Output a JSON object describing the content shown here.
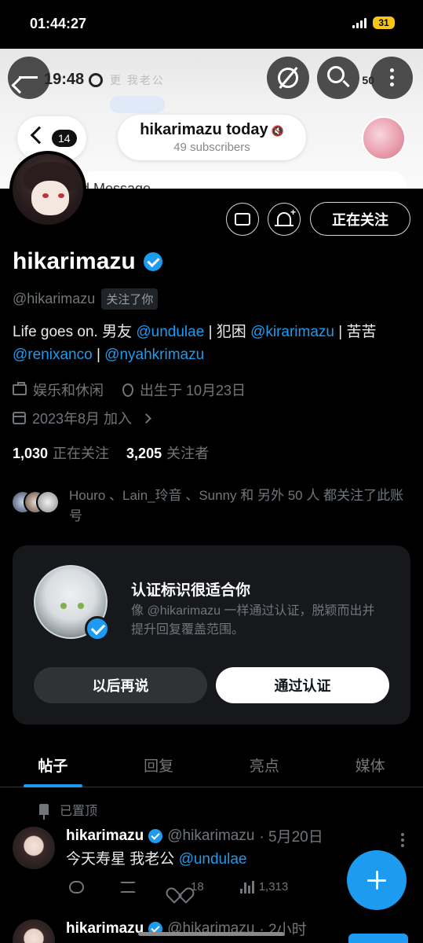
{
  "status_bar": {
    "time": "01:44:27",
    "battery": "31"
  },
  "banner": {
    "inner_time": "19:48",
    "inner_status": "50",
    "blurred_text": "更 我老公",
    "channel_title": "hikarimazu today",
    "subscribers": "49 subscribers",
    "back_count": "14",
    "message_partial": "d Message"
  },
  "header_icons": [
    "back-arrow-icon",
    "grok-icon",
    "search-icon",
    "more-icon"
  ],
  "profile": {
    "mail_button": "mail-icon",
    "notify_button": "bell-plus-icon",
    "follow_button": "正在关注",
    "display_name": "hikarimazu",
    "handle": "@hikarimazu",
    "follows_you": "关注了你",
    "bio": {
      "t1": "Life goes on. 男友 ",
      "m1": "@undulae",
      "t2": " | 犯困 ",
      "m2": "@kirarimazu",
      "t3": " | 苦苦 ",
      "m3": "@renixanco",
      "t4": " | ",
      "m4": "@nyahkrimazu"
    },
    "category": "娱乐和休闲",
    "birthday": "出生于 10月23日",
    "joined": "2023年8月 加入",
    "following_count": "1,030",
    "following_label": "正在关注",
    "followers_count": "3,205",
    "followers_label": "关注者",
    "followed_by": "Houro 、Lain_玲音 、Sunny 和 另外 50 人 都关注了此账号"
  },
  "verify_card": {
    "title": "认证标识很适合你",
    "description": "像 @hikarimazu 一样通过认证，脱颖而出并提升回复覆盖范围。",
    "later_button": "以后再说",
    "verify_button": "通过认证"
  },
  "tabs": [
    "帖子",
    "回复",
    "亮点",
    "媒体"
  ],
  "pinned_label": "已置顶",
  "post": {
    "name": "hikarimazu",
    "handle": "@hikarimazu",
    "date": "· 5月20日",
    "text_prefix": "今天寿星 我老公 ",
    "mention": "@undulae",
    "likes": "18",
    "views": "1,313"
  },
  "next_post": {
    "name": "hikarimazu",
    "handle": "@hikarimazu",
    "time": "· 2小时"
  },
  "colors": {
    "accent": "#1d9bf0",
    "background": "#000000",
    "card": "#16181c",
    "muted": "#71767b"
  }
}
